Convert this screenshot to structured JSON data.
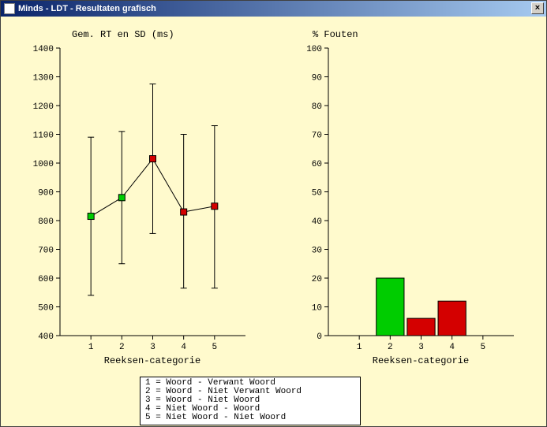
{
  "window": {
    "title": "Minds - LDT - Resultaten grafisch",
    "close_label": "×"
  },
  "legend": {
    "l1": "1 = Woord - Verwant Woord",
    "l2": "2 = Woord - Niet Verwant Woord",
    "l3": "3 = Woord - Niet Woord",
    "l4": "4 = Niet Woord - Woord",
    "l5": "5 = Niet Woord - Niet Woord"
  },
  "chart_data": [
    {
      "type": "line",
      "title": "Gem. RT en SD (ms)",
      "xlabel": "Reeksen-categorie",
      "ylabel": "",
      "categories": [
        1,
        2,
        3,
        4,
        5
      ],
      "ylim": [
        400,
        1400
      ],
      "yticks": [
        400,
        500,
        600,
        700,
        800,
        900,
        1000,
        1100,
        1200,
        1300,
        1400
      ],
      "series": [
        {
          "name": "RT",
          "values": [
            815,
            880,
            1015,
            830,
            850
          ],
          "err_low": [
            540,
            650,
            755,
            565,
            565
          ],
          "err_high": [
            1090,
            1110,
            1275,
            1100,
            1130
          ],
          "colors": [
            "green",
            "green",
            "red",
            "red",
            "red"
          ]
        }
      ]
    },
    {
      "type": "bar",
      "title": "% Fouten",
      "xlabel": "Reeksen-categorie",
      "ylabel": "",
      "categories": [
        1,
        2,
        3,
        4,
        5
      ],
      "ylim": [
        0,
        100
      ],
      "yticks": [
        0,
        10,
        20,
        30,
        40,
        50,
        60,
        70,
        80,
        90,
        100
      ],
      "series": [
        {
          "name": "%Fouten",
          "values": [
            0,
            20,
            6,
            12,
            0
          ],
          "colors": [
            "green",
            "green",
            "red",
            "red",
            "red"
          ]
        }
      ]
    }
  ]
}
